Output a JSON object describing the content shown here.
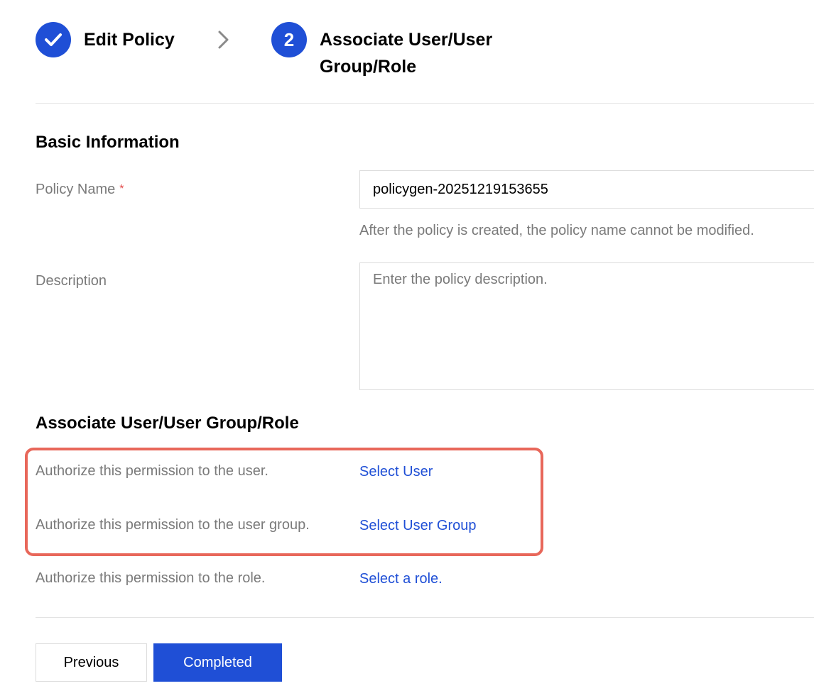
{
  "steps": [
    {
      "label": "Edit Policy",
      "status": "completed"
    },
    {
      "number": "2",
      "label_line1": "Associate User/User",
      "label_line2": "Group/Role",
      "status": "current"
    }
  ],
  "basic_info": {
    "title": "Basic Information",
    "policy_name": {
      "label": "Policy Name",
      "required_mark": "*",
      "value": "policygen-20251219153655",
      "hint": "After the policy is created, the policy name cannot be modified."
    },
    "description": {
      "label": "Description",
      "placeholder": "Enter the policy description."
    }
  },
  "associate": {
    "title": "Associate User/User Group/Role",
    "rows": [
      {
        "label": "Authorize this permission to the user.",
        "link": "Select User"
      },
      {
        "label": "Authorize this permission to the user group.",
        "link": "Select User Group"
      },
      {
        "label": "Authorize this permission to the role.",
        "link": "Select a role."
      }
    ]
  },
  "buttons": {
    "previous": "Previous",
    "completed": "Completed"
  },
  "colors": {
    "primary": "#1f4fd6",
    "highlight": "#e8675a",
    "required": "#e34d4d",
    "muted_text": "#7a7a7a"
  }
}
